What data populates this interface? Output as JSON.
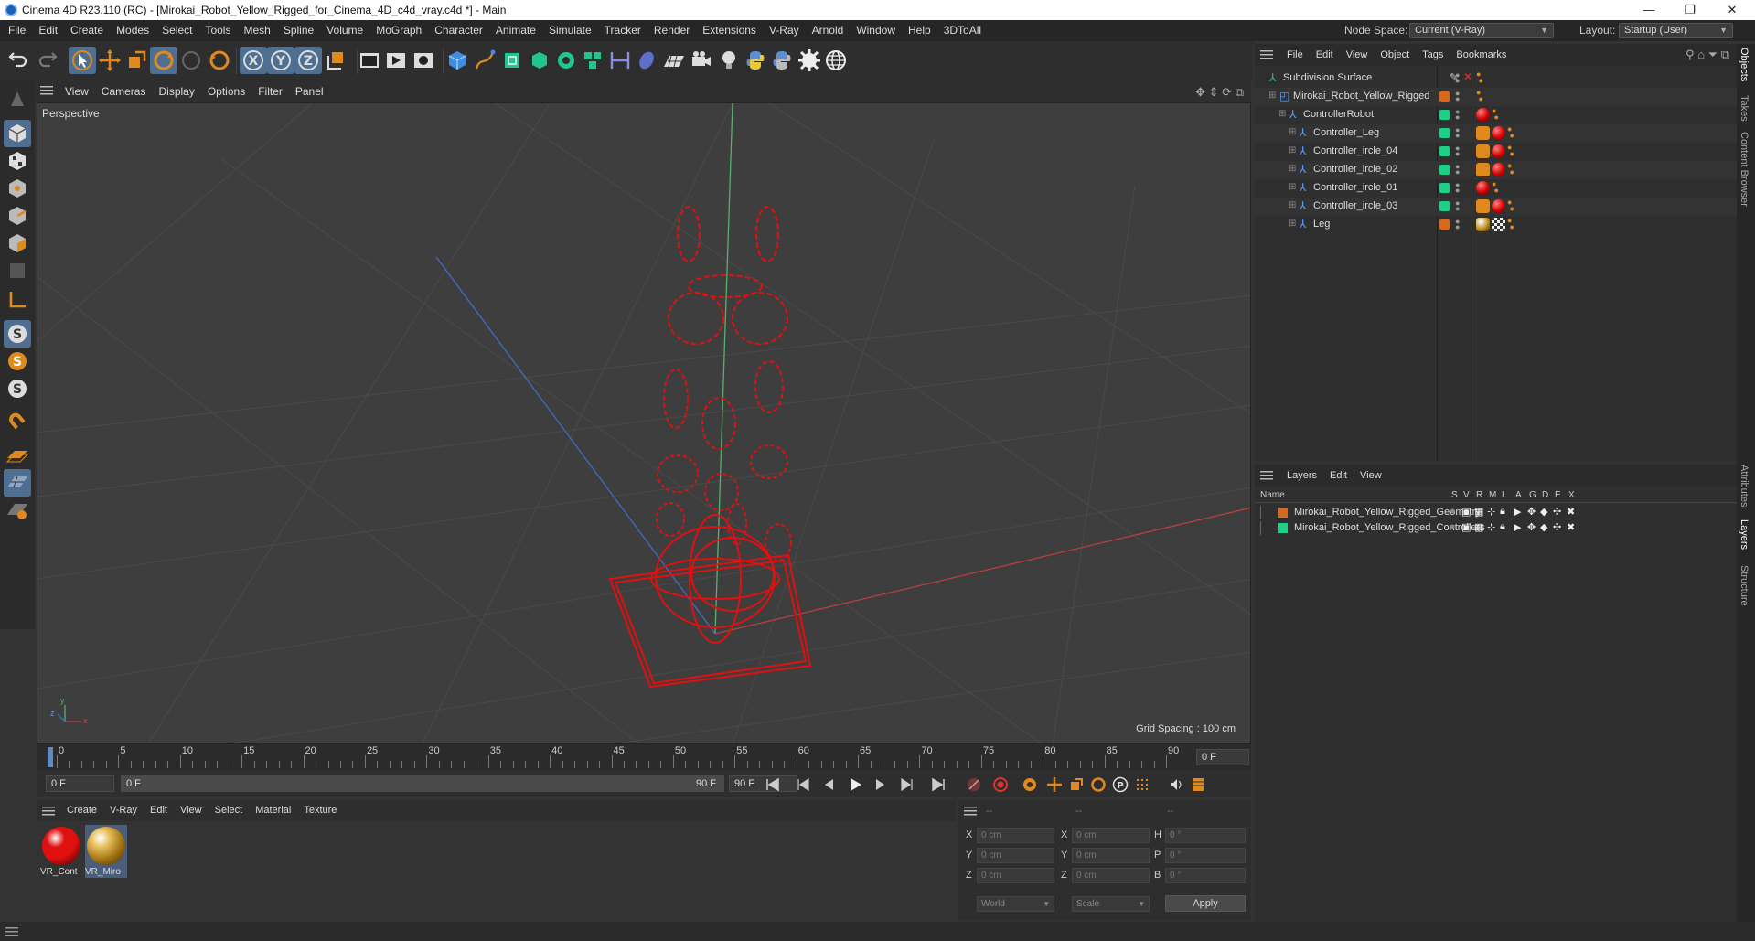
{
  "window": {
    "title": "Cinema 4D R23.110 (RC) - [Mirokai_Robot_Yellow_Rigged_for_Cinema_4D_c4d_vray.c4d *] - Main",
    "minimize": "—",
    "maximize": "❐",
    "close": "✕"
  },
  "menu": [
    "File",
    "Edit",
    "Create",
    "Modes",
    "Select",
    "Tools",
    "Mesh",
    "Spline",
    "Volume",
    "MoGraph",
    "Character",
    "Animate",
    "Simulate",
    "Tracker",
    "Render",
    "Extensions",
    "V-Ray",
    "Arnold",
    "Window",
    "Help",
    "3DToAll"
  ],
  "node_space": {
    "label": "Node Space:",
    "value": "Current (V-Ray)"
  },
  "layout": {
    "label": "Layout:",
    "value": "Startup (User)"
  },
  "viewport": {
    "menu": [
      "View",
      "Cameras",
      "Display",
      "Options",
      "Filter",
      "Panel"
    ],
    "label": "Perspective",
    "grid_spacing": "Grid Spacing : 100 cm",
    "axis_y": "y",
    "axis_x": "x",
    "axis_z": "z"
  },
  "timeline": {
    "ticks": [
      "0",
      "5",
      "10",
      "15",
      "20",
      "25",
      "30",
      "35",
      "40",
      "45",
      "50",
      "55",
      "60",
      "65",
      "70",
      "75",
      "80",
      "85",
      "90"
    ],
    "current_frame": "0 F"
  },
  "playback": {
    "start": "0 F",
    "range_start": "0 F",
    "range_end": "90 F",
    "end": "90 F"
  },
  "materials": {
    "menu": [
      "Create",
      "V-Ray",
      "Edit",
      "View",
      "Select",
      "Material",
      "Texture"
    ],
    "items": [
      {
        "name": "VR_Cont",
        "color": "#e01010"
      },
      {
        "name": "VR_Miro",
        "color": "#d4a020"
      }
    ]
  },
  "coords": {
    "hdr": [
      "--",
      "--",
      "--"
    ],
    "rows": [
      {
        "a": "X",
        "av": "0 cm",
        "b": "X",
        "bv": "0 cm",
        "c": "H",
        "cv": "0 °"
      },
      {
        "a": "Y",
        "av": "0 cm",
        "b": "Y",
        "bv": "0 cm",
        "c": "P",
        "cv": "0 °"
      },
      {
        "a": "Z",
        "av": "0 cm",
        "b": "Z",
        "bv": "0 cm",
        "c": "B",
        "cv": "0 °"
      }
    ],
    "world": "World",
    "scale": "Scale",
    "apply": "Apply"
  },
  "objects": {
    "menu": [
      "File",
      "Edit",
      "View",
      "Object",
      "Tags",
      "Bookmarks"
    ],
    "rows": [
      {
        "name": "Subdivision Surface",
        "indent": 0,
        "tag": "#888",
        "balls": []
      },
      {
        "name": "Mirokai_Robot_Yellow_Rigged",
        "indent": 1,
        "tag": "#d56a1e",
        "balls": []
      },
      {
        "name": "ControllerRobot",
        "indent": 2,
        "tag": "#1ecf86",
        "balls": [
          "r"
        ]
      },
      {
        "name": "Controller_Leg",
        "indent": 3,
        "tag": "#1ecf86",
        "balls": [
          "s",
          "r"
        ]
      },
      {
        "name": "Controller_ircle_04",
        "indent": 3,
        "tag": "#1ecf86",
        "balls": [
          "s",
          "r"
        ]
      },
      {
        "name": "Controller_ircle_02",
        "indent": 3,
        "tag": "#1ecf86",
        "balls": [
          "s",
          "r"
        ]
      },
      {
        "name": "Controller_ircle_01",
        "indent": 3,
        "tag": "#1ecf86",
        "balls": [
          "r"
        ]
      },
      {
        "name": "Controller_ircle_03",
        "indent": 3,
        "tag": "#1ecf86",
        "balls": [
          "s",
          "r"
        ]
      },
      {
        "name": "Leg",
        "indent": 3,
        "tag": "#d56a1e",
        "balls": [
          "y",
          "c"
        ]
      }
    ]
  },
  "layers": {
    "menu": [
      "Layers",
      "Edit",
      "View"
    ],
    "cols": [
      "Name",
      "S",
      "V",
      "R",
      "M",
      "L",
      "A",
      "G",
      "D",
      "E",
      "X"
    ],
    "rows": [
      {
        "name": "Mirokai_Robot_Yellow_Rigged_Geometry",
        "color": "#d56a1e"
      },
      {
        "name": "Mirokai_Robot_Yellow_Rigged_Controllers",
        "color": "#1ecf86"
      }
    ]
  },
  "right_tabs": [
    "Objects",
    "Takes",
    "Content Browser",
    "Attributes",
    "Layers",
    "Structure"
  ]
}
